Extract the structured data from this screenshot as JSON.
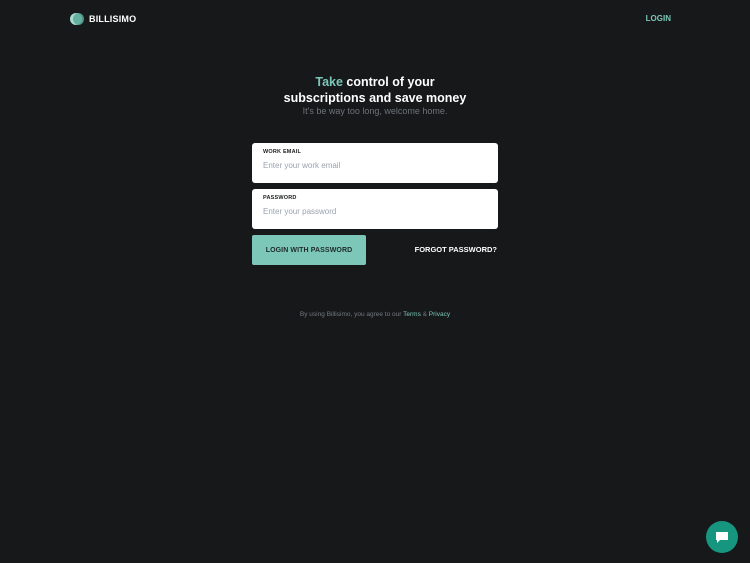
{
  "header": {
    "brand": "BILLISIMO",
    "login_link": "LOGIN"
  },
  "hero": {
    "accent_word": "Take",
    "headline_line1_rest": " control of your",
    "headline_line2": "subscriptions and save money",
    "subtitle": "It's be way too long, welcome home."
  },
  "form": {
    "email_label": "WORK EMAIL",
    "email_placeholder": "Enter your work email",
    "email_value": "",
    "password_label": "PASSWORD",
    "password_placeholder": "Enter your password",
    "password_value": "",
    "login_button": "LOGIN WITH PASSWORD",
    "forgot_link": "FORGOT PASSWORD?"
  },
  "legal": {
    "prefix": "By using Billisimo, you agree to our ",
    "terms": "Terms",
    "and": " & ",
    "privacy": "Privacy"
  },
  "icons": {
    "logo": "billisimo-logo-icon",
    "chat": "chat-bubble-icon"
  },
  "colors": {
    "background": "#16181a",
    "accent": "#7cc7b8",
    "chat_button": "#17967f"
  }
}
